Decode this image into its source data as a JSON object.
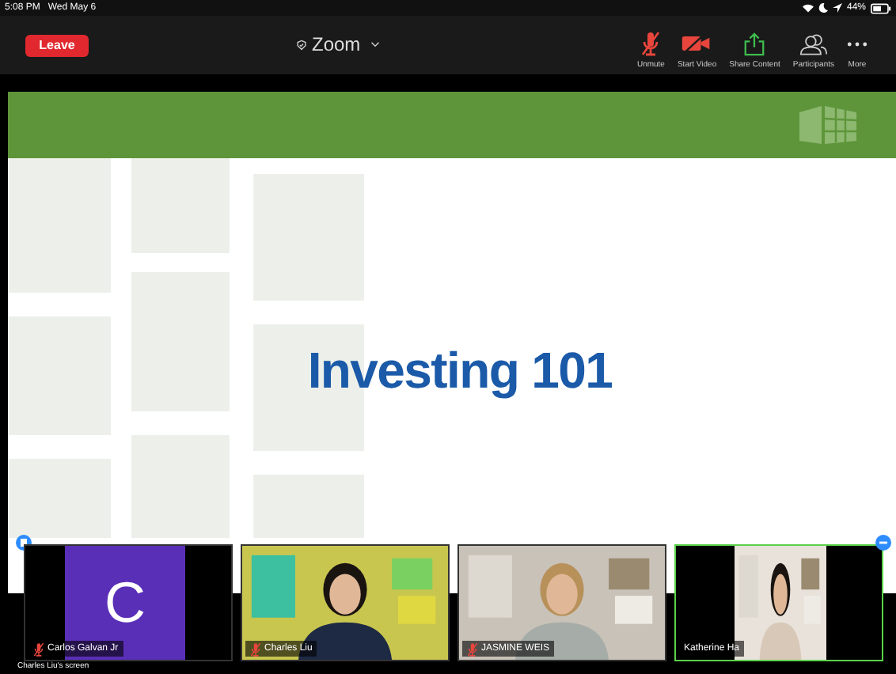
{
  "status_bar": {
    "time": "5:08 PM",
    "date": "Wed May 6",
    "battery": "44%"
  },
  "toolbar": {
    "leave": "Leave",
    "title": "Zoom",
    "buttons": [
      {
        "kind": "mic",
        "label": "Unmute",
        "muted": true
      },
      {
        "kind": "video",
        "label": "Start Video",
        "muted": true
      },
      {
        "kind": "share",
        "label": "Share Content"
      },
      {
        "kind": "participants",
        "label": "Participants"
      },
      {
        "kind": "more",
        "label": "More"
      }
    ]
  },
  "slide": {
    "title": "Investing 101"
  },
  "participants": [
    {
      "name": "Carlos Galvan Jr",
      "kind": "avatar",
      "initial": "C",
      "muted": true,
      "speaking": false
    },
    {
      "name": "Charles Liu",
      "kind": "video",
      "muted": true,
      "speaking": false
    },
    {
      "name": "JASMINE WEIS",
      "kind": "video",
      "muted": true,
      "speaking": false
    },
    {
      "name": "Katherine Ha",
      "kind": "video",
      "muted": false,
      "speaking": true
    }
  ],
  "screen_label": "Charles Liu's screen"
}
